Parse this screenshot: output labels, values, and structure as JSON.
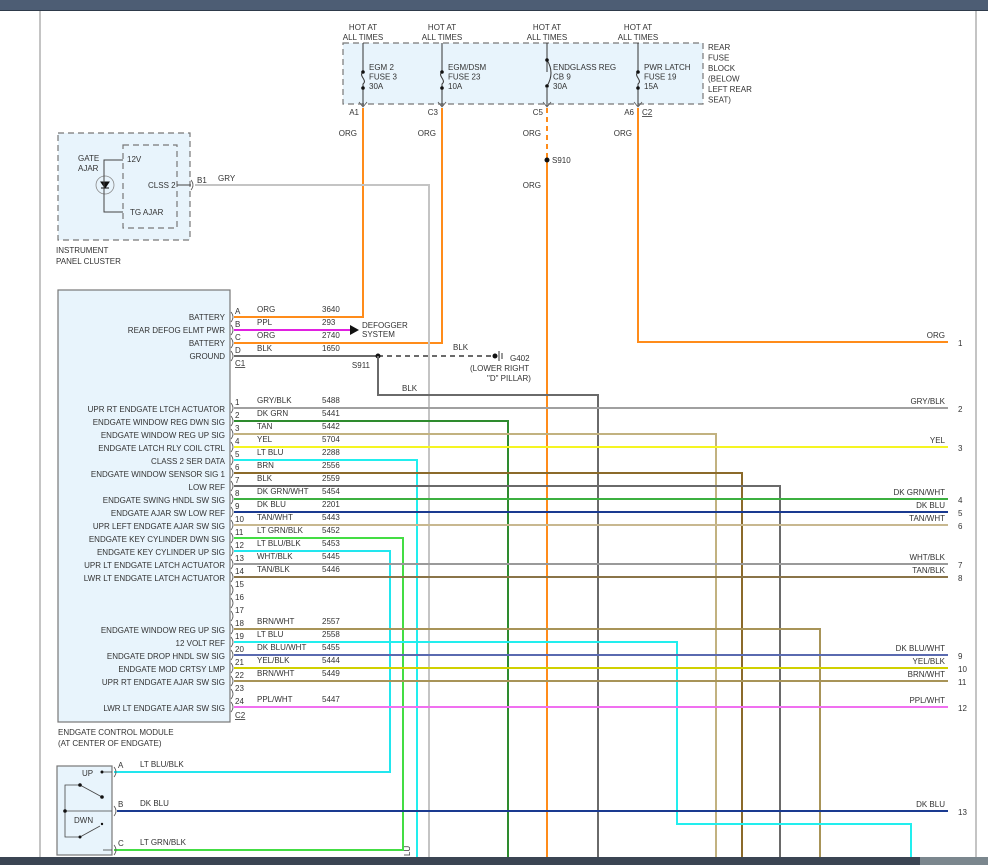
{
  "fuse_block": {
    "label": [
      "REAR",
      "FUSE",
      "BLOCK",
      "(BELOW",
      "LEFT REAR",
      "SEAT)"
    ],
    "connector": "C2",
    "fuses": [
      {
        "hot": [
          "HOT AT",
          "ALL TIMES"
        ],
        "name": [
          "EGM 2",
          "FUSE 3",
          "30A"
        ],
        "cavity": "A1",
        "wire": "ORG"
      },
      {
        "hot": [
          "HOT AT",
          "ALL TIMES"
        ],
        "name": [
          "EGM/DSM",
          "FUSE 23",
          "10A"
        ],
        "cavity": "C3",
        "wire": "ORG"
      },
      {
        "hot": [
          "HOT AT",
          "ALL TIMES"
        ],
        "name": [
          "ENDGLASS REG",
          "CB 9",
          "30A"
        ],
        "cavity": "C5",
        "wire": "ORG"
      },
      {
        "hot": [
          "HOT AT",
          "ALL TIMES"
        ],
        "name": [
          "PWR LATCH",
          "FUSE 19",
          "15A"
        ],
        "cavity": "A6",
        "wire": "ORG"
      }
    ]
  },
  "splices": {
    "s910": "S910",
    "s910_wire": "ORG",
    "s911": "S911",
    "s911_wire": "BLK"
  },
  "ground": {
    "wire": "BLK",
    "label": [
      "G402",
      "(LOWER RIGHT",
      "\"D\" PILLAR)"
    ]
  },
  "defogger": [
    "DEFOGGER",
    "SYSTEM"
  ],
  "cluster": {
    "name": [
      "INSTRUMENT",
      "PANEL CLUSTER"
    ],
    "indicator": [
      "GATE",
      "AJAR"
    ],
    "pins": [
      "12V",
      "CLSS 2",
      "TG AJAR"
    ],
    "cavity": "B1",
    "wire": "GRY"
  },
  "module": {
    "name": [
      "ENDGATE CONTROL MODULE",
      "(AT CENTER OF ENDGATE)"
    ],
    "c1": {
      "connector": "C1",
      "pins": [
        {
          "pin": "A",
          "func": "BATTERY",
          "wire": "ORG",
          "circuit": "3640"
        },
        {
          "pin": "B",
          "func": "REAR DEFOG ELMT PWR",
          "wire": "PPL",
          "circuit": "293"
        },
        {
          "pin": "C",
          "func": "BATTERY",
          "wire": "ORG",
          "circuit": "2740"
        },
        {
          "pin": "D",
          "func": "GROUND",
          "wire": "BLK",
          "circuit": "1650"
        }
      ]
    },
    "c2": {
      "connector": "C2",
      "pins": [
        {
          "pin": "1",
          "func": "UPR RT ENDGATE LTCH ACTUATOR",
          "wire": "GRY/BLK",
          "circuit": "5488"
        },
        {
          "pin": "2",
          "func": "ENDGATE WINDOW REG DWN SIG",
          "wire": "DK GRN",
          "circuit": "5441"
        },
        {
          "pin": "3",
          "func": "ENDGATE WINDOW REG UP SIG",
          "wire": "TAN",
          "circuit": "5442"
        },
        {
          "pin": "4",
          "func": "ENDGATE LATCH RLY COIL CTRL",
          "wire": "YEL",
          "circuit": "5704"
        },
        {
          "pin": "5",
          "func": "CLASS 2 SER DATA",
          "wire": "LT BLU",
          "circuit": "2288"
        },
        {
          "pin": "6",
          "func": "ENDGATE WINDOW SENSOR SIG 1",
          "wire": "BRN",
          "circuit": "2556"
        },
        {
          "pin": "7",
          "func": "LOW REF",
          "wire": "BLK",
          "circuit": "2559"
        },
        {
          "pin": "8",
          "func": "ENDGATE SWING HNDL SW SIG",
          "wire": "DK GRN/WHT",
          "circuit": "5454"
        },
        {
          "pin": "9",
          "func": "ENDGATE AJAR SW LOW REF",
          "wire": "DK BLU",
          "circuit": "2201"
        },
        {
          "pin": "10",
          "func": "UPR LEFT ENDGATE AJAR SW SIG",
          "wire": "TAN/WHT",
          "circuit": "5443"
        },
        {
          "pin": "11",
          "func": "ENDGATE KEY CYLINDER DWN SIG",
          "wire": "LT GRN/BLK",
          "circuit": "5452"
        },
        {
          "pin": "12",
          "func": "ENDGATE KEY CYLINDER UP SIG",
          "wire": "LT BLU/BLK",
          "circuit": "5453"
        },
        {
          "pin": "13",
          "func": "UPR LT ENDGATE LATCH ACTUATOR",
          "wire": "WHT/BLK",
          "circuit": "5445"
        },
        {
          "pin": "14",
          "func": "LWR LT ENDGATE LATCH ACTUATOR",
          "wire": "TAN/BLK",
          "circuit": "5446"
        },
        {
          "pin": "15",
          "func": "",
          "wire": "",
          "circuit": ""
        },
        {
          "pin": "16",
          "func": "",
          "wire": "",
          "circuit": ""
        },
        {
          "pin": "17",
          "func": "",
          "wire": "",
          "circuit": ""
        },
        {
          "pin": "18",
          "func": "ENDGATE WINDOW REG UP SIG",
          "wire": "BRN/WHT",
          "circuit": "2557"
        },
        {
          "pin": "19",
          "func": "12 VOLT REF",
          "wire": "LT BLU",
          "circuit": "2558"
        },
        {
          "pin": "20",
          "func": "ENDGATE DROP HNDL SW SIG",
          "wire": "DK BLU/WHT",
          "circuit": "5455"
        },
        {
          "pin": "21",
          "func": "ENDGATE MOD CRTSY LMP",
          "wire": "YEL/BLK",
          "circuit": "5444"
        },
        {
          "pin": "22",
          "func": "UPR RT ENDGATE AJAR SW SIG",
          "wire": "BRN/WHT",
          "circuit": "5449"
        },
        {
          "pin": "23",
          "func": "",
          "wire": "",
          "circuit": ""
        },
        {
          "pin": "24",
          "func": "LWR LT ENDGATE AJAR SW SIG",
          "wire": "PPL/WHT",
          "circuit": "5447"
        }
      ]
    }
  },
  "switch": {
    "labels": [
      "UP",
      "DWN"
    ],
    "pins": [
      {
        "pin": "A",
        "wire": "LT BLU/BLK"
      },
      {
        "pin": "B",
        "wire": "DK BLU"
      },
      {
        "pin": "C",
        "wire": "LT GRN/BLK"
      }
    ]
  },
  "right_terminals": [
    {
      "n": "1",
      "wire": "ORG"
    },
    {
      "n": "2",
      "wire": "GRY/BLK"
    },
    {
      "n": "3",
      "wire": "YEL"
    },
    {
      "n": "4",
      "wire": "DK GRN/WHT"
    },
    {
      "n": "5",
      "wire": "DK BLU"
    },
    {
      "n": "6",
      "wire": "TAN/WHT"
    },
    {
      "n": "7",
      "wire": "WHT/BLK"
    },
    {
      "n": "8",
      "wire": "TAN/BLK"
    },
    {
      "n": "9",
      "wire": "DK BLU/WHT"
    },
    {
      "n": "10",
      "wire": "YEL/BLK"
    },
    {
      "n": "11",
      "wire": "BRN/WHT"
    },
    {
      "n": "12",
      "wire": "PPL/WHT"
    },
    {
      "n": "13",
      "wire": "DK BLU"
    }
  ],
  "partial_label": "LU",
  "wire_colors": {
    "ORG": "#ff8c1a",
    "PPL": "#e020e0",
    "BLK": "#6a6a6a",
    "GRY": "#c4c4c4",
    "GRY/BLK": "#a0a0a0",
    "DK GRN": "#2e8b2e",
    "TAN": "#c2b280",
    "YEL": "#f5f522",
    "LT BLU": "#22eeee",
    "BRN": "#8b6a2a",
    "DK GRN/WHT": "#3cb040",
    "DK BLU": "#1a3a90",
    "TAN/WHT": "#c8b890",
    "LT GRN/BLK": "#44dd44",
    "LT BLU/BLK": "#22e6ee",
    "WHT/BLK": "#9a9a9a",
    "TAN/BLK": "#8a7448",
    "BRN/WHT": "#a89458",
    "DK BLU/WHT": "#5a6ab0",
    "YEL/BLK": "#d0d000",
    "PPL/WHT": "#f070f0"
  }
}
